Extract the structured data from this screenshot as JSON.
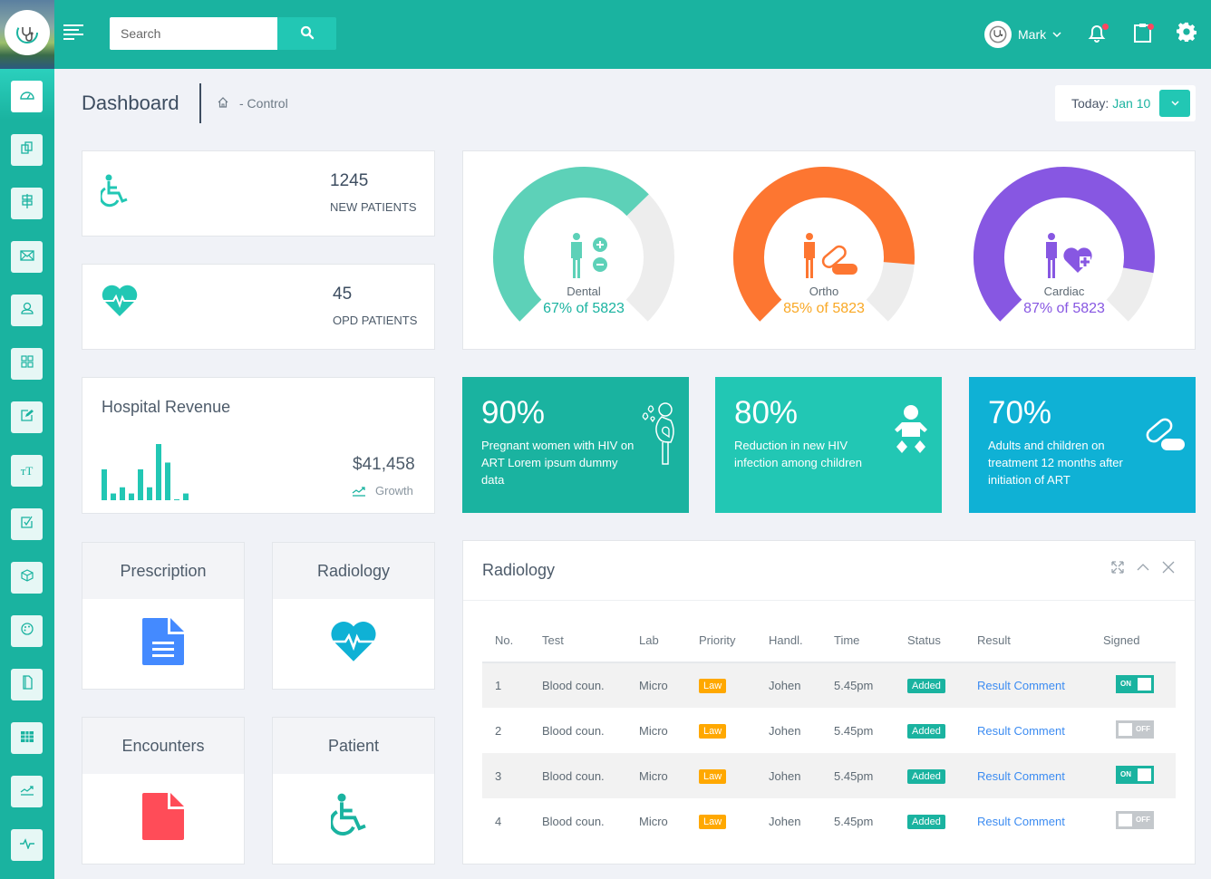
{
  "header": {
    "search_placeholder": "Search",
    "user_name": "Mark",
    "icons": [
      "logo-stethoscope-icon",
      "menu-icon",
      "search-icon",
      "chevron-down-icon",
      "bell-icon",
      "clipboard-icon",
      "gear-icon"
    ]
  },
  "sidebar": {
    "items": [
      {
        "icon": "dashboard-gauge-icon",
        "active": true
      },
      {
        "icon": "copy-icon"
      },
      {
        "icon": "signpost-icon"
      },
      {
        "icon": "mail-icon"
      },
      {
        "icon": "user-icon"
      },
      {
        "icon": "grid-icon"
      },
      {
        "icon": "edit-icon"
      },
      {
        "icon": "text-size-icon"
      },
      {
        "icon": "checkbox-icon"
      },
      {
        "icon": "cube-icon"
      },
      {
        "icon": "palette-icon"
      },
      {
        "icon": "book-icon"
      },
      {
        "icon": "table-icon"
      },
      {
        "icon": "chart-line-icon"
      },
      {
        "icon": "pulse-icon"
      }
    ]
  },
  "page": {
    "title": "Dashboard",
    "breadcrumb": "- Control",
    "date_label": "Today:",
    "date_value": "Jan 10"
  },
  "stats": [
    {
      "value": "1245",
      "label": "NEW PATIENTS",
      "icon": "wheelchair-icon"
    },
    {
      "value": "45",
      "label": "OPD PATIENTS",
      "icon": "heart-pulse-icon"
    }
  ],
  "gauges": [
    {
      "name": "Dental",
      "text": "67% of 5823",
      "percent": 67,
      "color": "#5dd1b8",
      "text_color": "#1ab3a0"
    },
    {
      "name": "Ortho",
      "text": "85% of 5823",
      "percent": 85,
      "color": "#fd7631",
      "text_color": "#f9a825"
    },
    {
      "name": "Cardiac",
      "text": "87% of 5823",
      "percent": 87,
      "color": "#8757e2",
      "text_color": "#8757e2"
    }
  ],
  "revenue": {
    "title": "Hospital Revenue",
    "amount": "$41,458",
    "growth_label": "Growth",
    "bars": [
      55,
      12,
      23,
      12,
      55,
      23,
      100,
      67,
      1,
      12
    ]
  },
  "info_cards": [
    {
      "percent": "90%",
      "text": "Pregnant women with HIV on ART Lorem ipsum dummy data",
      "color": "#1ab3a0",
      "icon": "pregnant-woman-icon"
    },
    {
      "percent": "80%",
      "text": "Reduction in new HIV infection among children",
      "color": "#22c7b4",
      "icon": "baby-icon"
    },
    {
      "percent": "70%",
      "text": "Adults and children on treatment 12 months after initiation of ART",
      "color": "#0fb1d5",
      "icon": "pills-icon"
    }
  ],
  "tiles": [
    {
      "label": "Prescription",
      "icon": "document-icon"
    },
    {
      "label": "Radiology",
      "icon": "heart-pulse-icon"
    },
    {
      "label": "Encounters",
      "icon": "file-icon"
    },
    {
      "label": "Patient",
      "icon": "wheelchair-icon"
    }
  ],
  "radiology": {
    "title": "Radiology",
    "columns": [
      "No.",
      "Test",
      "Lab",
      "Priority",
      "Handl.",
      "Time",
      "Status",
      "Result",
      "Signed"
    ],
    "rows": [
      {
        "no": "1",
        "test": "Blood coun.",
        "lab": "Micro",
        "priority": "Law",
        "handler": "Johen",
        "time": "5.45pm",
        "status": "Added",
        "result": "Result Comment",
        "signed": "ON"
      },
      {
        "no": "2",
        "test": "Blood coun.",
        "lab": "Micro",
        "priority": "Law",
        "handler": "Johen",
        "time": "5.45pm",
        "status": "Added",
        "result": "Result Comment",
        "signed": "OFF"
      },
      {
        "no": "3",
        "test": "Blood coun.",
        "lab": "Micro",
        "priority": "Law",
        "handler": "Johen",
        "time": "5.45pm",
        "status": "Added",
        "result": "Result Comment",
        "signed": "ON"
      },
      {
        "no": "4",
        "test": "Blood coun.",
        "lab": "Micro",
        "priority": "Law",
        "handler": "Johen",
        "time": "5.45pm",
        "status": "Added",
        "result": "Result Comment",
        "signed": "OFF"
      }
    ]
  }
}
